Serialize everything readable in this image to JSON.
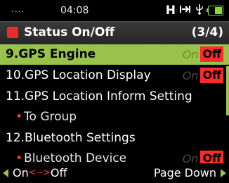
{
  "status_bar": {
    "dots": "....",
    "time": "04:08",
    "network_letter": "H",
    "icons": [
      "signal-icon",
      "usb-icon",
      "battery-icon"
    ]
  },
  "title_bar": {
    "title": "Status On/Off",
    "page": "(3/4)",
    "accent_color": "#ee2a2a"
  },
  "items": [
    {
      "label": "9.GPS Engine",
      "on": "On",
      "off": "Off",
      "state": "Off",
      "selected": true
    },
    {
      "label": "10.GPS Location Display",
      "on": "On",
      "off": "Off",
      "state": "Off"
    },
    {
      "label": "11.GPS Location Inform Setting"
    },
    {
      "label": "To Group",
      "sub": true
    },
    {
      "label": "12.Bluetooth Settings"
    },
    {
      "label": "Bluetooth Device",
      "sub": true,
      "on": "On",
      "off": "Off",
      "state": "Off"
    }
  ],
  "softkeys": {
    "left_on": "On",
    "left_arrow": "<-->",
    "left_off": "Off",
    "right": "Page Down"
  },
  "colors": {
    "selection": "#98c24a",
    "off_badge": "#ff2a2a"
  }
}
